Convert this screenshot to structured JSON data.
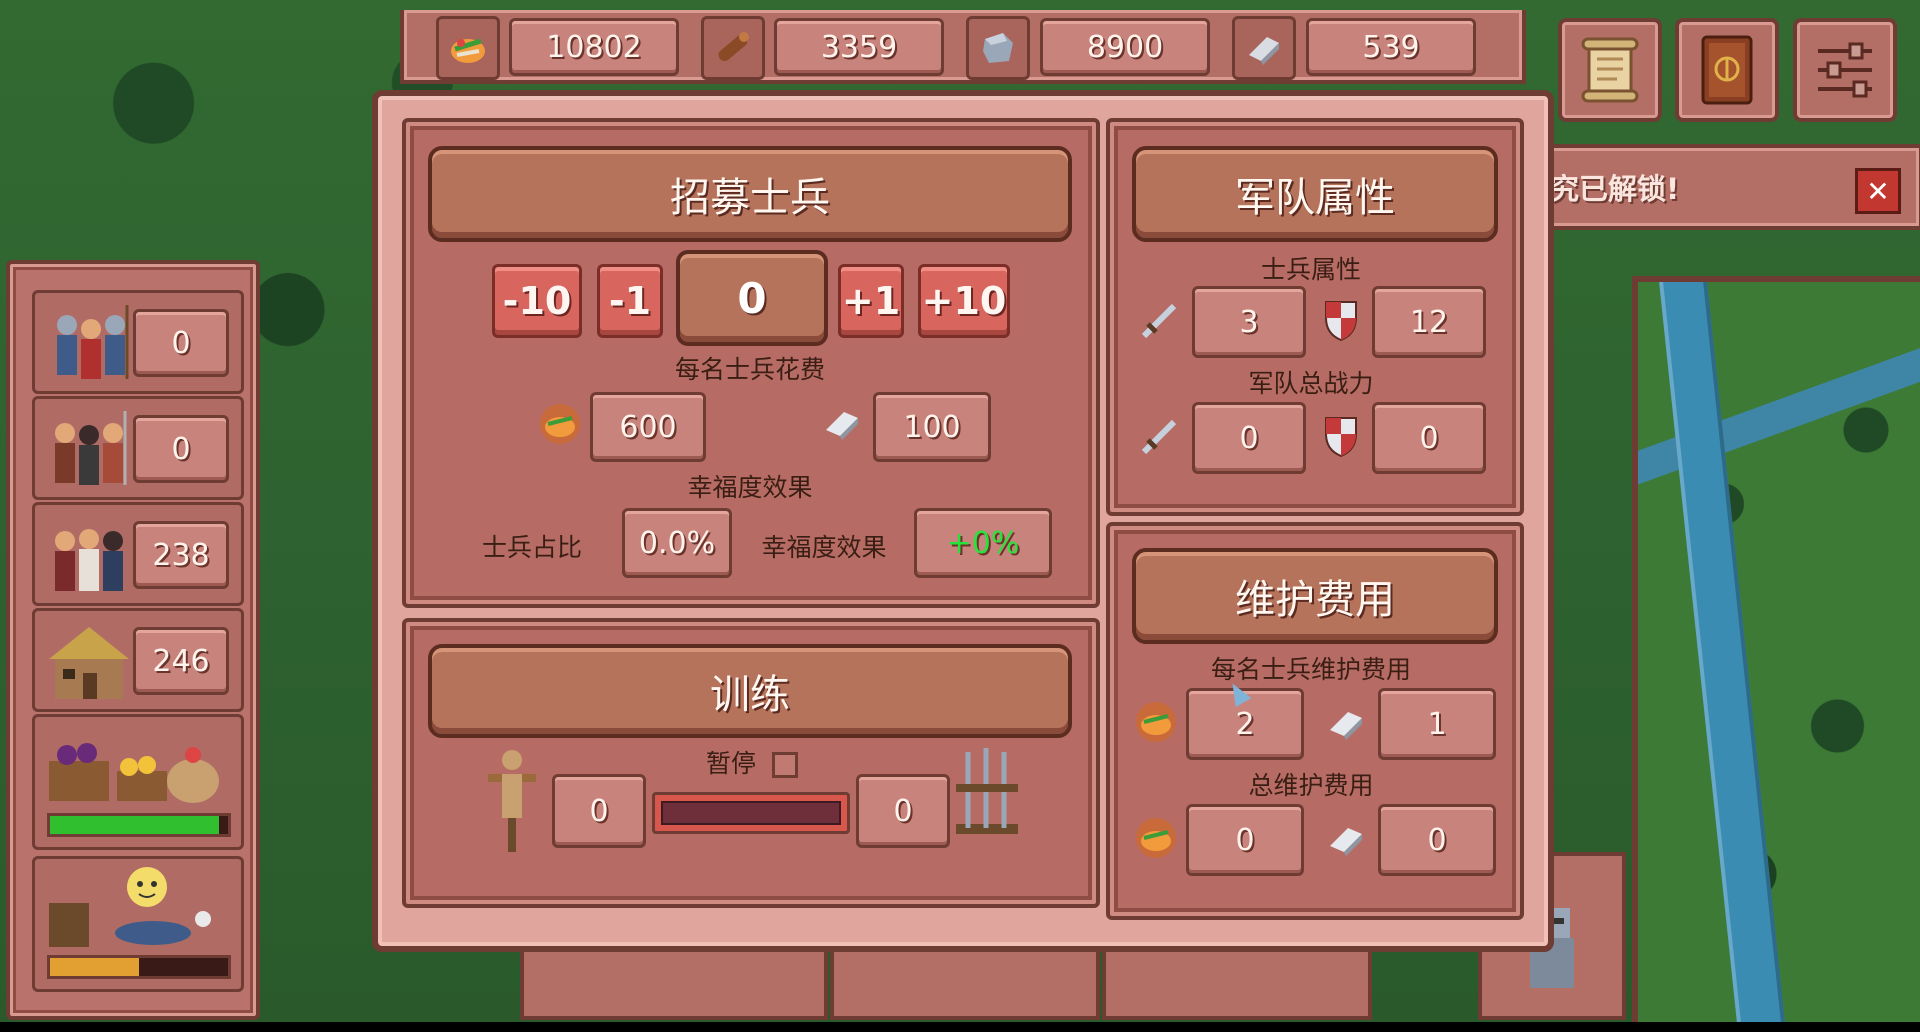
{
  "resources": {
    "food": {
      "icon": "food-icon",
      "value": "10802"
    },
    "wood": {
      "icon": "wood-log-icon",
      "value": "3359"
    },
    "stone": {
      "icon": "stone-icon",
      "value": "8900"
    },
    "iron": {
      "icon": "iron-ingot-icon",
      "value": "539"
    }
  },
  "top_buttons": [
    {
      "name": "scroll-quests-button",
      "icon": "scroll-icon"
    },
    {
      "name": "codex-book-button",
      "icon": "book-icon"
    },
    {
      "name": "settings-button",
      "icon": "sliders-icon"
    }
  ],
  "notification": {
    "text": "究已解锁!",
    "close": "✕"
  },
  "sidebar": {
    "soldiers": "0",
    "workers": "0",
    "population": "238",
    "housing": "246",
    "food_level": 0.95,
    "happiness_level": 0.5
  },
  "recruit": {
    "title": "招募士兵",
    "minus10": "-10",
    "minus1": "-1",
    "count": "0",
    "plus1": "+1",
    "plus10": "+10",
    "cost_label": "每名士兵花费",
    "cost_food": "600",
    "cost_iron": "100",
    "happiness_label": "幸福度效果",
    "ratio_label": "士兵占比",
    "ratio_value": "0.0%",
    "effect_label": "幸福度效果",
    "effect_value": "+0%"
  },
  "training": {
    "title": "训练",
    "pause_label": "暂停",
    "left_value": "0",
    "right_value": "0",
    "progress": 0
  },
  "army": {
    "title": "军队属性",
    "soldier_stats_label": "士兵属性",
    "soldier_attack": "3",
    "soldier_defense": "12",
    "total_label": "军队总战力",
    "total_attack": "0",
    "total_defense": "0"
  },
  "upkeep": {
    "title": "维护费用",
    "per_soldier_label": "每名士兵维护费用",
    "per_food": "2",
    "per_iron": "1",
    "total_label": "总维护费用",
    "total_food": "0",
    "total_iron": "0"
  },
  "colors": {
    "accent_green": "#27e33a",
    "frame_dark": "#6e3c33",
    "panel": "#b66c64"
  }
}
